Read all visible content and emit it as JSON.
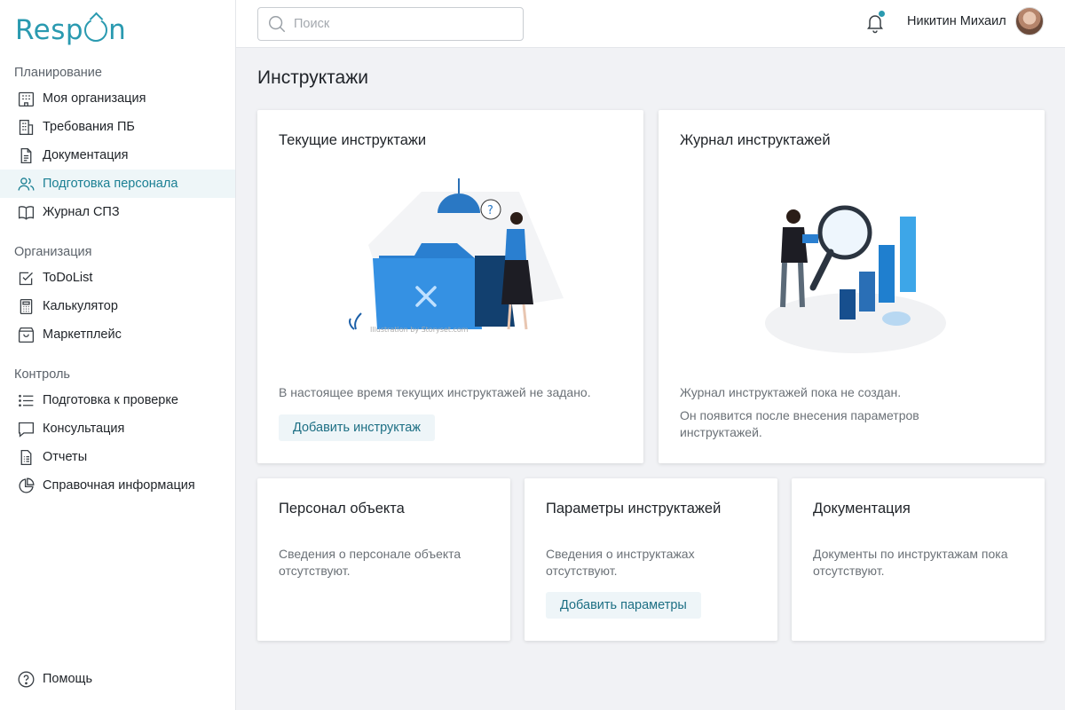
{
  "app": {
    "logo": "Respon"
  },
  "sidebar": {
    "sections": [
      {
        "title": "Планирование"
      },
      {
        "title": "Организация"
      },
      {
        "title": "Контроль"
      }
    ],
    "items": [
      {
        "label": "Моя организация",
        "icon": "building-icon"
      },
      {
        "label": "Требования ПБ",
        "icon": "office-building-icon"
      },
      {
        "label": "Документация",
        "icon": "document-icon"
      },
      {
        "label": "Подготовка персонала",
        "icon": "users-icon",
        "active": true
      },
      {
        "label": "Журнал СПЗ",
        "icon": "book-icon"
      },
      {
        "label": "ToDoList",
        "icon": "checkbox-icon"
      },
      {
        "label": "Калькулятор",
        "icon": "calculator-icon"
      },
      {
        "label": "Маркетплейс",
        "icon": "shop-bag-icon"
      },
      {
        "label": "Подготовка к проверке",
        "icon": "list-icon"
      },
      {
        "label": "Консультация",
        "icon": "chat-icon"
      },
      {
        "label": "Отчеты",
        "icon": "report-icon"
      },
      {
        "label": "Справочная информация",
        "icon": "pie-icon"
      }
    ],
    "help": {
      "label": "Помощь",
      "icon": "question-circle-icon"
    }
  },
  "header": {
    "search_placeholder": "Поиск",
    "user_name": "Никитин Михаил",
    "accent": "#2a9ab0"
  },
  "page": {
    "title": "Инструктажи",
    "cards": {
      "current": {
        "title": "Текущие инструктажи",
        "text": "В настоящее время текущих инструктажей не задано.",
        "button": "Добавить инструктаж",
        "illustration_credit": "Illustration by Storyset.com"
      },
      "journal": {
        "title": "Журнал инструктажей",
        "text1": "Журнал инструктажей пока не создан.",
        "text2": "Он появится после внесения параметров инструктажей."
      },
      "personnel": {
        "title": "Персонал объекта",
        "text": "Сведения о персонале объекта отсутствуют."
      },
      "params": {
        "title": "Параметры инструктажей",
        "text": "Сведения о инструктажах отсутствуют.",
        "button": "Добавить параметры"
      },
      "docs": {
        "title": "Документация",
        "text": "Документы по инструктажам пока отсутствуют."
      }
    }
  }
}
